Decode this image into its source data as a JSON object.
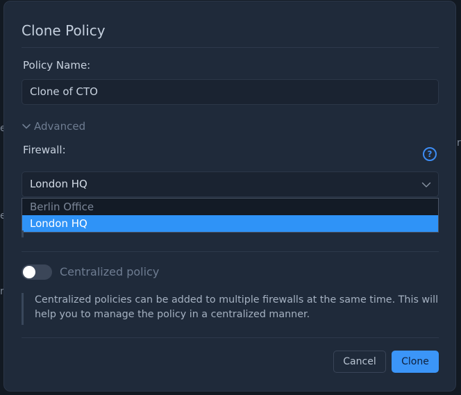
{
  "dialog": {
    "title": "Clone Policy",
    "policy_name_label": "Policy Name:",
    "policy_name_value": "Clone of CTO",
    "advanced_label": "Advanced",
    "firewall_label": "Firewall:",
    "help_glyph": "?",
    "firewall_selected": "London HQ",
    "firewall_options": [
      "Berlin Office",
      "London HQ"
    ],
    "centralized_toggle_on": false,
    "centralized_label": "Centralized policy",
    "centralized_note": "Centralized policies can be added to multiple firewalls at the same time. This will help you to manage the policy in a centralized manner.",
    "cancel_label": "Cancel",
    "clone_label": "Clone"
  },
  "icons": {
    "advanced_toggle": "chevron-down-icon",
    "select_caret": "chevron-down-icon",
    "help": "question-circle-icon"
  },
  "colors": {
    "dialog_bg": "#1f2a3a",
    "accent": "#3b95f8",
    "selected_option_bg": "#2f93f7",
    "muted_text": "#6f7d92"
  }
}
